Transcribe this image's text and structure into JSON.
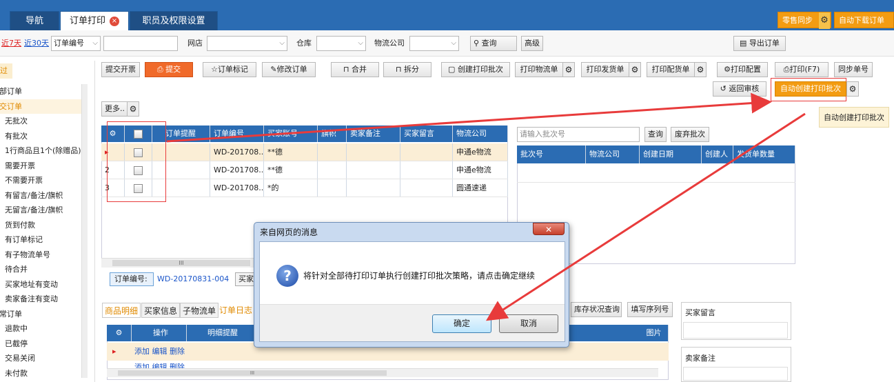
{
  "top_tabs": [
    {
      "label": "导航"
    },
    {
      "label": "订单打印",
      "close": "×"
    },
    {
      "label": "职员及权限设置"
    }
  ],
  "top_right": {
    "sync_label": "零售同步",
    "download_label": "自动下载订单"
  },
  "filter": {
    "recent7": "近7天",
    "recent30": "近30天",
    "order_field": "订单编号",
    "shop_label": "网店",
    "warehouse_label": "仓库",
    "logistics_label": "物流公司",
    "query_label": "查询",
    "advanced_label": "高级",
    "export_label": "导出订单"
  },
  "sidebar": {
    "header": "过滤",
    "items": [
      "全部订单",
      "提交订单",
      "无批次",
      "有批次",
      "1行商品且1个(除赠品)",
      "需要开票",
      "不需要开票",
      "有留言/备注/旗帜",
      "无留言/备注/旗帜",
      "货到付款",
      "有订单标记",
      "有子物流单号",
      "待合并",
      "买家地址有变动",
      "卖家备注有变动",
      "异常订单",
      "退款中",
      "已截停",
      "交易关闭",
      "未付款"
    ]
  },
  "toolbar": {
    "invoice": "提交开票",
    "submit": "提交",
    "mark": "订单标记",
    "edit": "修改订单",
    "merge": "合并",
    "split": "拆分",
    "create_batch": "创建打印批次",
    "print_logistics": "打印物流单",
    "print_ship": "打印发货单",
    "print_picking": "打印配货单",
    "print_config": "打印配置",
    "print": "打印(F7)",
    "sync_no": "同步单号",
    "back_review": "返回审核",
    "auto_batch": "自动创建打印批次",
    "auto_batch_tooltip": "自动创建打印批次",
    "more": "更多.."
  },
  "orders": {
    "columns": [
      "订单提醒",
      "订单编号",
      "买家账号",
      "旗帜",
      "卖家备注",
      "买家留言",
      "物流公司"
    ],
    "rows": [
      {
        "no": "1",
        "order_id": "WD-201708...",
        "buyer": "**德",
        "logistics": "申通e物流"
      },
      {
        "no": "2",
        "order_id": "WD-201708...",
        "buyer": "**德",
        "logistics": "申通e物流"
      },
      {
        "no": "3",
        "order_id": "WD-201708...",
        "buyer": "*的",
        "logistics": "圆通速递"
      }
    ],
    "scroll_glyph": "III"
  },
  "detail": {
    "order_no_label": "订单编号:",
    "order_no_value": "WD-20170831-004",
    "buyer_partial": "买家"
  },
  "batch": {
    "placeholder": "请输入批次号",
    "query": "查询",
    "discard": "废弃批次",
    "columns": [
      "批次号",
      "物流公司",
      "创建日期",
      "创建人",
      "发货单数量"
    ]
  },
  "bottom": {
    "tabs": [
      "商品明细",
      "买家信息",
      "子物流单",
      "订单日志"
    ],
    "columns": [
      "操作",
      "明细提醒"
    ],
    "pic_col": "图片",
    "row_actions": "添加 编辑 删除",
    "row2_actions": "添加 编辑 删除",
    "stock_btn": "库存状况查询",
    "serial_btn": "填写序列号",
    "buyer_msg": "买家留言",
    "seller_note": "卖家备注",
    "scroll_glyph": "III"
  },
  "dialog": {
    "title": "来自网页的消息",
    "close": "✕",
    "message": "将针对全部待打印订单执行创建打印批次策略，请点击确定继续",
    "ok": "确定",
    "cancel": "取消"
  },
  "colors": {
    "header_blue": "#2b6cb3",
    "accent_orange": "#f39c12",
    "submit_orange": "#f06a2a",
    "arrow_red": "#e83b3b"
  }
}
